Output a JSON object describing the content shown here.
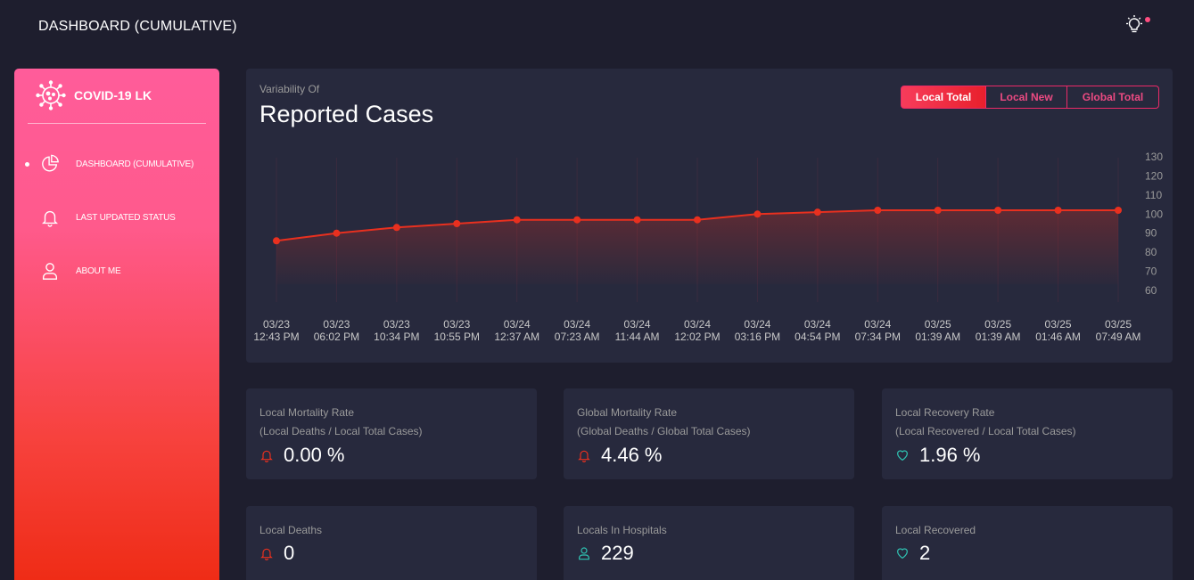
{
  "header": {
    "title": "DASHBOARD (CUMULATIVE)"
  },
  "sidebar": {
    "brand": "COVID-19 LK",
    "items": [
      {
        "label": "DASHBOARD (CUMULATIVE)",
        "icon": "pie-chart-icon",
        "active": true
      },
      {
        "label": "LAST UPDATED STATUS",
        "icon": "bell-icon",
        "active": false
      },
      {
        "label": "ABOUT ME",
        "icon": "user-icon",
        "active": false
      }
    ]
  },
  "chart_card": {
    "subtitle": "Variability Of",
    "title": "Reported Cases",
    "buttons": [
      "Local Total",
      "Local New",
      "Global Total"
    ],
    "active_button": "Local Total"
  },
  "chart_data": {
    "type": "line",
    "title": "Reported Cases",
    "x": [
      "03/23 12:43 PM",
      "03/23 06:02 PM",
      "03/23 10:34 PM",
      "03/23 10:55 PM",
      "03/24 12:37 AM",
      "03/24 07:23 AM",
      "03/24 11:44 AM",
      "03/24 12:02 PM",
      "03/24 03:16 PM",
      "03/24 04:54 PM",
      "03/24 07:34 PM",
      "03/25 01:39 AM",
      "03/25 01:39 AM",
      "03/25 01:46 AM",
      "03/25 07:49 AM"
    ],
    "x_dates": [
      "03/23",
      "03/23",
      "03/23",
      "03/23",
      "03/24",
      "03/24",
      "03/24",
      "03/24",
      "03/24",
      "03/24",
      "03/24",
      "03/25",
      "03/25",
      "03/25",
      "03/25"
    ],
    "x_times": [
      "12:43 PM",
      "06:02 PM",
      "10:34 PM",
      "10:55 PM",
      "12:37 AM",
      "07:23 AM",
      "11:44 AM",
      "12:02 PM",
      "03:16 PM",
      "04:54 PM",
      "07:34 PM",
      "01:39 AM",
      "01:39 AM",
      "01:46 AM",
      "07:49 AM"
    ],
    "series": [
      {
        "values": [
          86,
          90,
          93,
          95,
          97,
          97,
          97,
          97,
          100,
          101,
          102,
          102,
          102,
          102,
          102
        ]
      }
    ],
    "ylim": [
      60,
      130
    ],
    "yticks": [
      130,
      120,
      110,
      100,
      90,
      80,
      70,
      60
    ],
    "y_axis_position": "right",
    "grid": "vertical",
    "colors": {
      "line": "#e8301f",
      "point": "#e8301f"
    }
  },
  "stats": [
    {
      "title": "Local Mortality Rate",
      "subtitle": "(Local Deaths / Local Total Cases)",
      "value": "0.00 %",
      "icon": "bell-icon"
    },
    {
      "title": "Global Mortality Rate",
      "subtitle": "(Global Deaths / Global Total Cases)",
      "value": "4.46 %",
      "icon": "bell-icon"
    },
    {
      "title": "Local Recovery Rate",
      "subtitle": "(Local Recovered / Local Total Cases)",
      "value": "1.96 %",
      "icon": "heart-icon"
    },
    {
      "title": "Local Deaths",
      "value": "0",
      "icon": "bell-icon"
    },
    {
      "title": "Locals In Hospitals",
      "value": "229",
      "icon": "user-icon"
    },
    {
      "title": "Local Recovered",
      "value": "2",
      "icon": "heart-icon"
    }
  ],
  "colors": {
    "background": "#1e1e2e",
    "card": "#27293d",
    "accent": "#ec2a68",
    "danger": "#e8301f",
    "teal": "#2fc3b3"
  }
}
